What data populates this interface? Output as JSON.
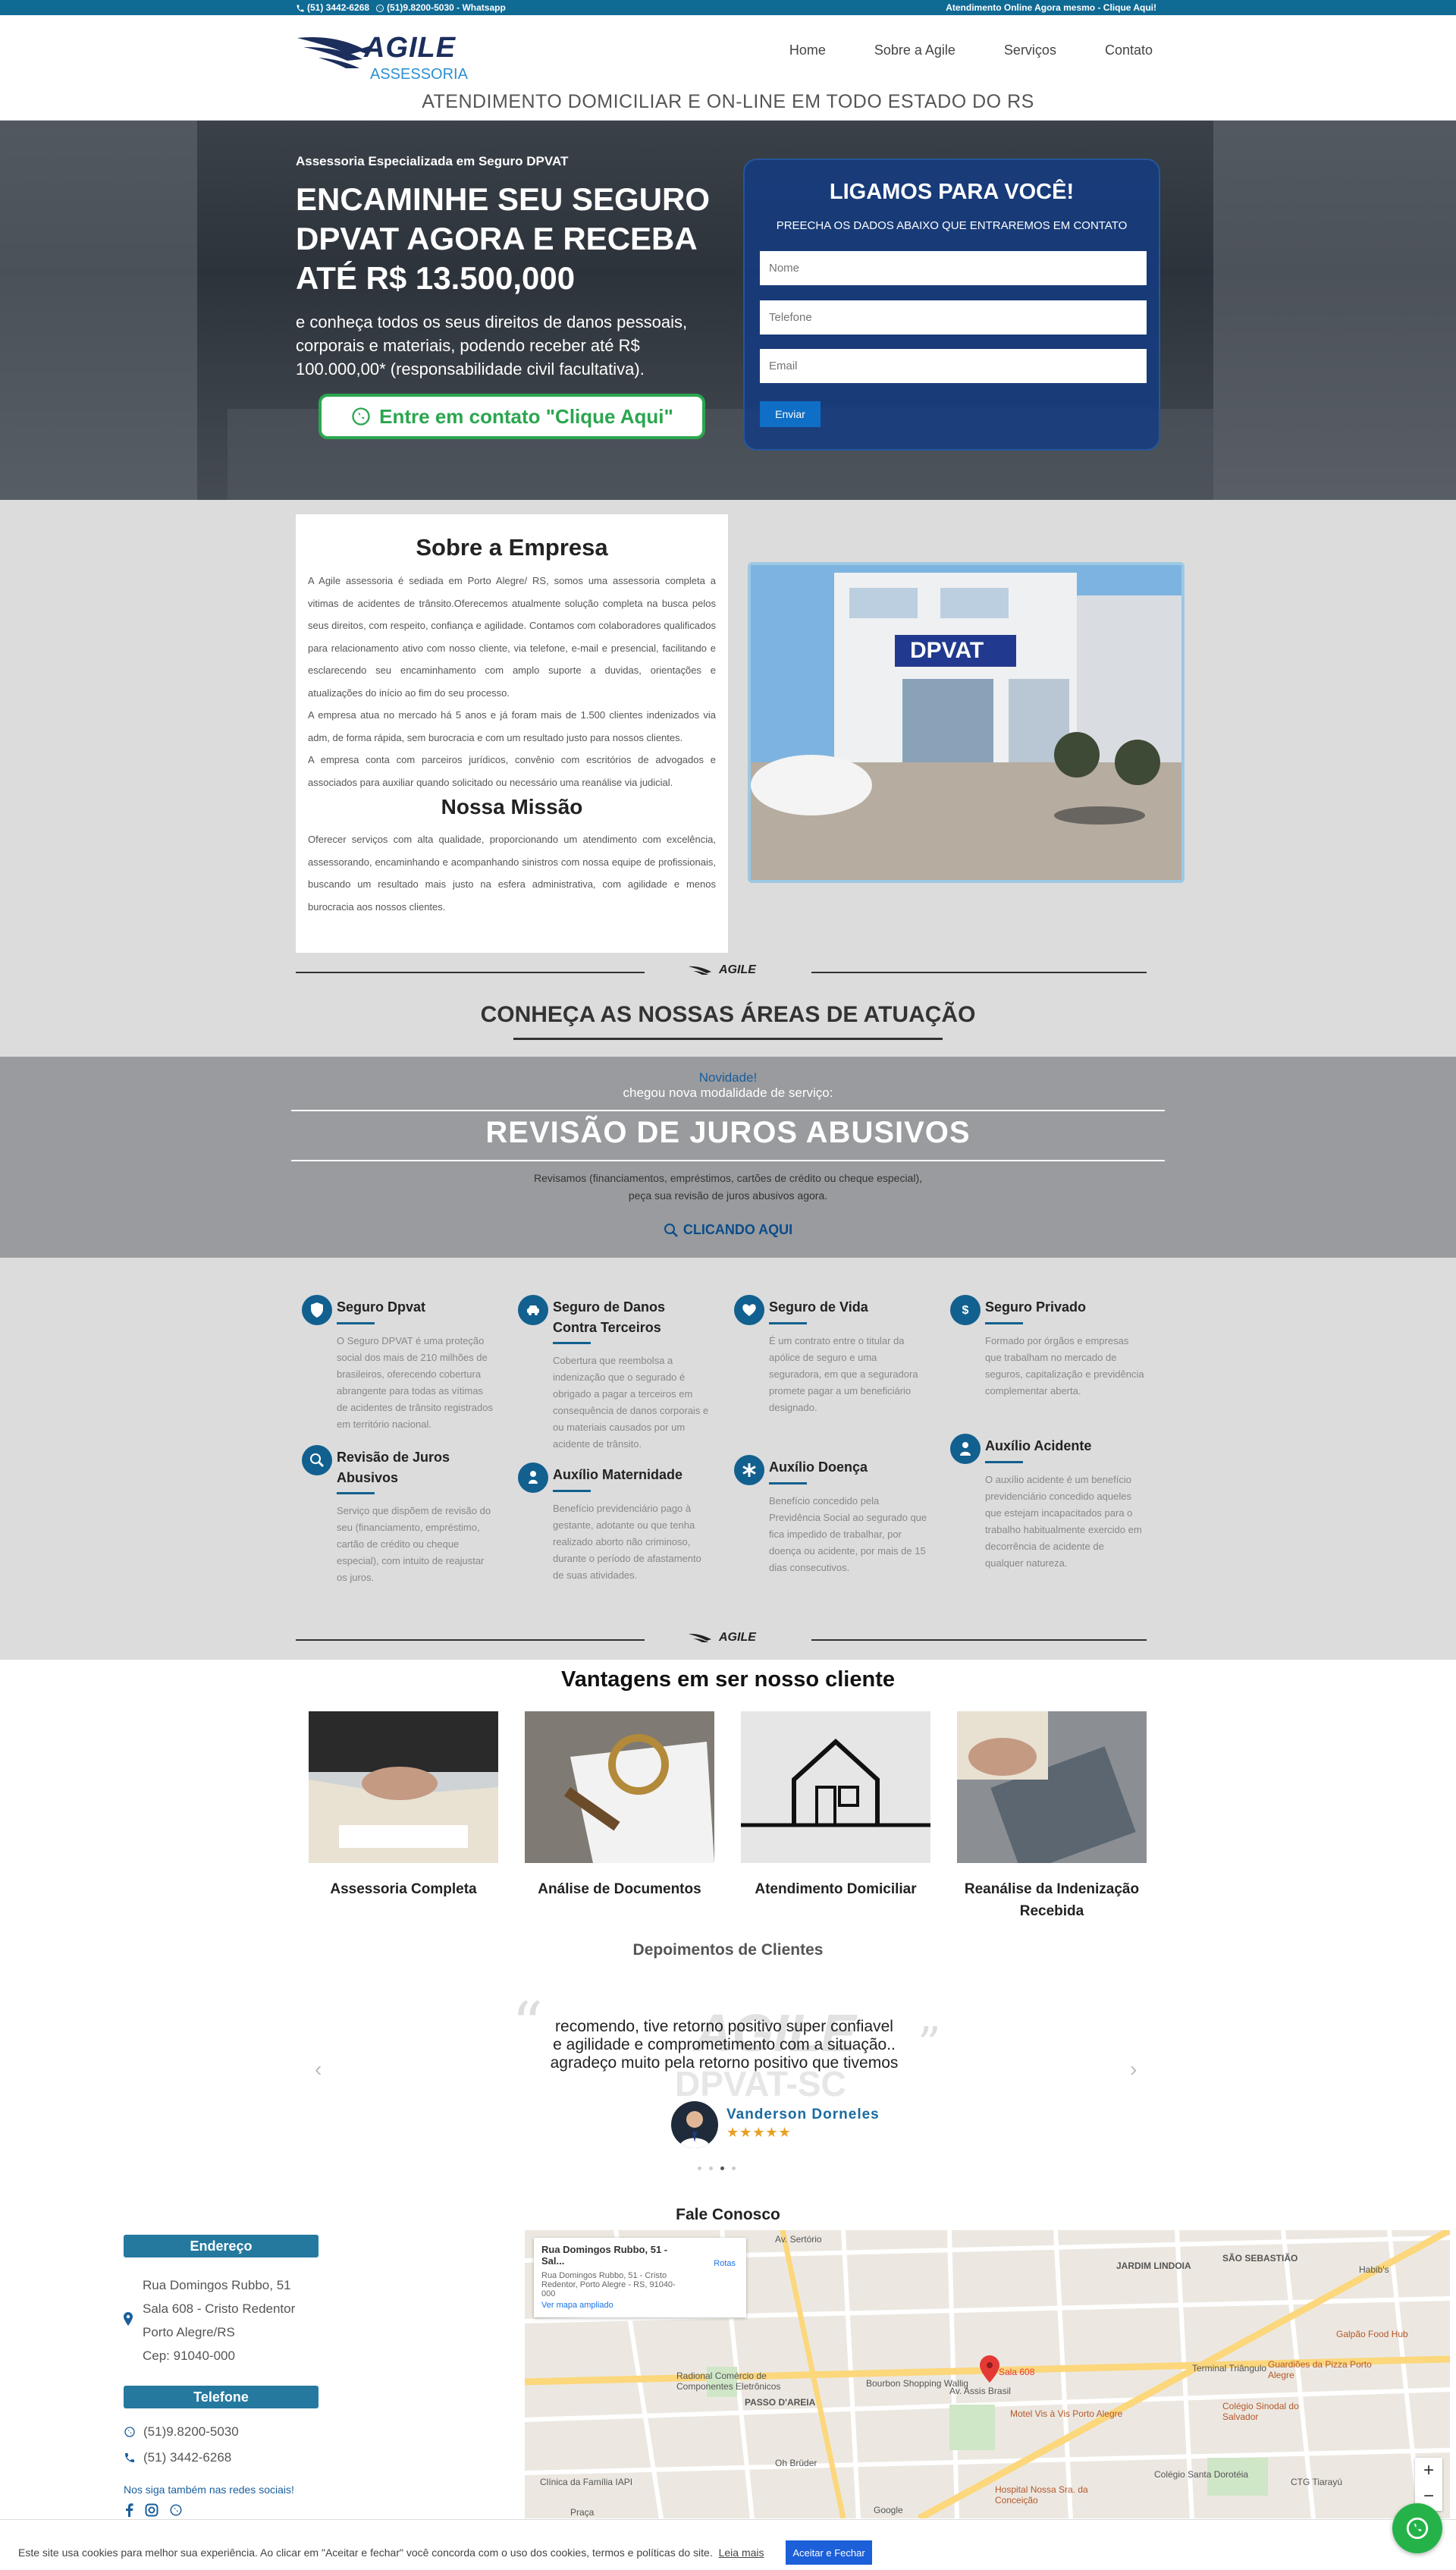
{
  "topbar": {
    "phone": "(51) 3442-6268",
    "whatsapp": "(51)9.8200-5030 - Whatsapp",
    "right_text": "Atendimento Online Agora mesmo - Clique Aqui!"
  },
  "logo": {
    "name": "AGILE",
    "sub": "ASSESSORIA"
  },
  "nav": {
    "items": [
      "Home",
      "Sobre a Agile",
      "Serviços",
      "Contato"
    ]
  },
  "tagline": "ATENDIMENTO DOMICILIAR E ON-LINE EM TODO ESTADO DO RS",
  "hero": {
    "subtitle": "Assessoria Especializada em Seguro DPVAT",
    "title": "ENCAMINHE SEU SEGURO DPVAT AGORA E RECEBA ATÉ R$ 13.500,000",
    "text": "e conheça todos os seus direitos de danos pessoais, corporais e materiais, podendo receber até R$ 100.000,00* (responsabilidade civil facultativa).",
    "button": "Entre em contato \"Clique Aqui\""
  },
  "form": {
    "title": "LIGAMOS PARA VOCÊ!",
    "subtitle": "PREECHA OS DADOS ABAIXO QUE ENTRAREMOS EM CONTATO",
    "name_ph": "Nome",
    "phone_ph": "Telefone",
    "email_ph": "Email",
    "submit": "Enviar"
  },
  "about": {
    "title": "Sobre a Empresa",
    "p1": "A Agile assessoria é sediada em Porto Alegre/ RS, somos uma assessoria completa a vitimas de acidentes de trânsito.Oferecemos atualmente solução completa na busca pelos seus direitos, com respeito, confiança e agilidade. Contamos com colaboradores qualificados para relacionamento ativo com nosso cliente, via telefone, e-mail e presencial, facilitando e esclarecendo seu encaminhamento com amplo suporte a duvidas, orientações e atualizações do início ao fim do seu processo.",
    "p2": "A empresa atua no mercado há 5 anos e já foram mais de 1.500 clientes indenizados via adm, de forma rápida, sem burocracia e com um resultado justo para nossos clientes.",
    "p3": "A empresa conta com parceiros jurídicos, convênio com escritórios de advogados e associados para auxiliar quando solicitado ou necessário uma reanálise via judicial.",
    "mission_title": "Nossa Missão",
    "mission": "Oferecer serviços com alta qualidade, proporcionando um atendimento com excelência, assessorando, encaminhando e acompanhando sinistros com nossa equipe de profissionais, buscando um resultado mais justo na esfera administrativa, com agilidade e menos burocracia aos nossos clientes.",
    "photo_sign": "DPVAT"
  },
  "areas": {
    "divider_logo": "AGILE",
    "title": "CONHEÇA AS NOSSAS ÁREAS DE ATUAÇÃO"
  },
  "revision": {
    "novidade": "Novidade!",
    "sub": "chegou nova modalidade de serviço:",
    "title": "REVISÃO DE JUROS ABUSIVOS",
    "text1": "Revisamos (financiamentos, empréstimos, cartões de crédito ou cheque especial),",
    "text2": "peça sua revisão de juros abusivos agora.",
    "link": "CLICANDO AQUI"
  },
  "services": [
    {
      "icon": "shield-icon",
      "title": "Seguro Dpvat",
      "desc": "O Seguro DPVAT é uma proteção social dos mais de 210 milhões de brasileiros, oferecendo cobertura abrangente para todas as vítimas de acidentes de trânsito registrados em território nacional."
    },
    {
      "icon": "car-crash-icon",
      "title": "Seguro de Danos Contra Terceiros",
      "desc": "Cobertura que reembolsa a indenização que o segurado é obrigado a pagar a terceiros em consequência de danos corporais e ou materiais causados por um acidente de trânsito."
    },
    {
      "icon": "heartbeat-icon",
      "title": "Seguro de Vida",
      "desc": "É um contrato entre o titular da apólice de seguro e uma seguradora, em que a seguradora promete pagar a um beneficiário designado."
    },
    {
      "icon": "dollar-icon",
      "title": "Seguro Privado",
      "desc": "Formado por órgãos e empresas que trabalham no mercado de seguros, capitalização e previdência complementar aberta."
    },
    {
      "icon": "search-money-icon",
      "title": "Revisão de Juros Abusivos",
      "desc": "Serviço que dispõem de revisão do seu (financiamento, empréstimo, cartão de crédito ou cheque especial), com intuito de reajustar os juros."
    },
    {
      "icon": "baby-icon",
      "title": "Auxílio Maternidade",
      "desc": "Benefício previdenciário pago à gestante, adotante ou que tenha realizado aborto não criminoso, durante o período de afastamento de suas atividades."
    },
    {
      "icon": "asterisk-icon",
      "title": "Auxílio Doença",
      "desc": "Benefício concedido pela Previdência Social ao segurado que fica impedido de trabalhar, por doença ou acidente, por mais de 15 dias consecutivos."
    },
    {
      "icon": "user-injured-icon",
      "title": "Auxílio Acidente",
      "desc": "O auxílio acidente é um benefício previdenciário concedido aqueles que estejam incapacitados para o trabalho habitualmente exercido em decorrência de acidente de qualquer natureza."
    }
  ],
  "vantagens": {
    "title": "Vantagens em ser nosso cliente",
    "items": [
      "Assessoria Completa",
      "Análise de Documentos",
      "Atendimento Domiciliar",
      "Reanálise da Indenização Recebida"
    ]
  },
  "depoimentos": {
    "title": "Depoimentos de Clientes",
    "quote": "recomendo, tive retorno positivo super confiavel e agilidade e comprometimento com a situação.. agradeço muito pela retorno positivo que tivemos",
    "name": "Vanderson Dorneles",
    "stars": "★★★★★",
    "watermark1": "AGILE",
    "watermark2": "DPVAT-SC"
  },
  "contato": {
    "title": "Fale Conosco",
    "endereco_label": "Endereço",
    "addr1": "Rua Domingos Rubbo, 51",
    "addr2": "Sala 608 - Cristo Redentor",
    "addr3": "Porto Alegre/RS",
    "addr4": "Cep: 91040-000",
    "telefone_label": "Telefone",
    "whats": "(51)9.8200-5030",
    "phone": "(51) 3442-6268",
    "social": "Nos siga também nas redes sociais!"
  },
  "map": {
    "card_title": "Rua Domingos Rubbo, 51 - Sal...",
    "card_addr": "Rua Domingos Rubbo, 51 - Cristo Redentor, Porto Alegre - RS, 91040-000",
    "card_routes": "Rotas",
    "card_link": "Ver mapa ampliado",
    "pin_label": "Sala 608",
    "labels": [
      "Av. Assis Brasil",
      "PASSO D'AREIA",
      "Bourbon Shopping Wallig",
      "Terminal Triângulo",
      "Colégio Sinodal do Salvador",
      "Motel Vis à Vis Porto Alegre",
      "Hospital Nossa Sra. da Conceição",
      "Clínica da Família IAPI",
      "Oh Brüder",
      "Colégio Santa Dorotéia",
      "Guardiões da Pizza Porto Alegre",
      "Galpão Food Hub",
      "JARDIM LINDOIA",
      "SÃO SEBASTIÃO",
      "Habib's",
      "Radional Comércio de Componentes Eletrônicos",
      "Praça",
      "CTG Tiarayú",
      "Av. Sertório",
      "Google"
    ]
  },
  "cookie": {
    "text": "Este site usa cookies para melhor sua experiência. Ao clicar em \"Aceitar e fechar\" você concorda com o uso dos cookies, termos e políticas do site.",
    "link": "Leia mais",
    "button": "Aceitar e Fechar"
  }
}
